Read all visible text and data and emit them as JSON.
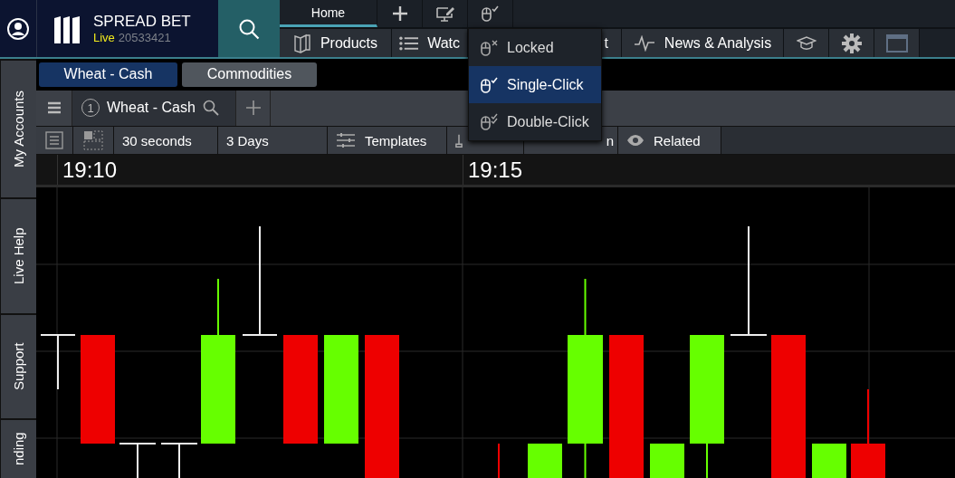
{
  "header": {
    "brand": {
      "title": "SPREAD BET",
      "status": "Live",
      "account_number": "20533421"
    }
  },
  "nav_top": [
    {
      "kind": "tab",
      "label": "Home",
      "selected": true
    },
    {
      "kind": "icon"
    },
    {
      "kind": "icon"
    },
    {
      "kind": "icon"
    }
  ],
  "nav_bottom": [
    {
      "kind": "text",
      "label": "Products"
    },
    {
      "kind": "text",
      "label": "Watc"
    },
    {
      "kind": "text",
      "label": "t"
    },
    {
      "kind": "text",
      "label": "News & Analysis"
    },
    {
      "kind": "icon"
    },
    {
      "kind": "icon"
    },
    {
      "kind": "icon"
    }
  ],
  "interaction_menu": [
    {
      "label": "Locked",
      "selected": false
    },
    {
      "label": "Single-Click",
      "selected": true
    },
    {
      "label": "Double-Click",
      "selected": false
    }
  ],
  "sidebar": [
    {
      "label": "My Accounts"
    },
    {
      "label": "Live Help"
    },
    {
      "label": "Support"
    },
    {
      "label": "nding"
    }
  ],
  "instrument_tabs": [
    {
      "label": "Wheat - Cash",
      "selected": true
    },
    {
      "label": "Commodities",
      "selected": false
    }
  ],
  "chart_tabs": [
    {
      "number": "1",
      "label": "Wheat - Cash"
    }
  ],
  "chart_toolbar": [
    {
      "kind": "icon"
    },
    {
      "kind": "icon"
    },
    {
      "kind": "text",
      "label": "30 seconds"
    },
    {
      "kind": "text",
      "label": "3 Days"
    },
    {
      "kind": "text",
      "label": "Templates"
    },
    {
      "kind": "icon"
    },
    {
      "kind": "text",
      "label": "n"
    },
    {
      "kind": "text",
      "label": "Related"
    }
  ],
  "time_axis": [
    "19:10",
    "19:15"
  ]
}
